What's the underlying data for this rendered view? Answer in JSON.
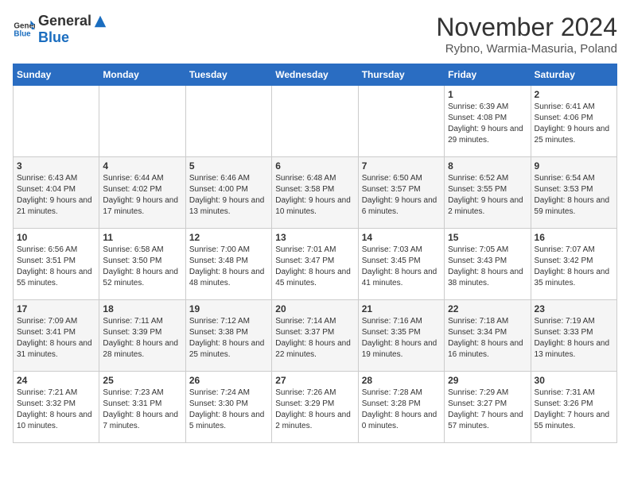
{
  "header": {
    "logo_general": "General",
    "logo_blue": "Blue",
    "title": "November 2024",
    "subtitle": "Rybno, Warmia-Masuria, Poland"
  },
  "days_of_week": [
    "Sunday",
    "Monday",
    "Tuesday",
    "Wednesday",
    "Thursday",
    "Friday",
    "Saturday"
  ],
  "weeks": [
    [
      {
        "day": "",
        "info": ""
      },
      {
        "day": "",
        "info": ""
      },
      {
        "day": "",
        "info": ""
      },
      {
        "day": "",
        "info": ""
      },
      {
        "day": "",
        "info": ""
      },
      {
        "day": "1",
        "info": "Sunrise: 6:39 AM\nSunset: 4:08 PM\nDaylight: 9 hours and 29 minutes."
      },
      {
        "day": "2",
        "info": "Sunrise: 6:41 AM\nSunset: 4:06 PM\nDaylight: 9 hours and 25 minutes."
      }
    ],
    [
      {
        "day": "3",
        "info": "Sunrise: 6:43 AM\nSunset: 4:04 PM\nDaylight: 9 hours and 21 minutes."
      },
      {
        "day": "4",
        "info": "Sunrise: 6:44 AM\nSunset: 4:02 PM\nDaylight: 9 hours and 17 minutes."
      },
      {
        "day": "5",
        "info": "Sunrise: 6:46 AM\nSunset: 4:00 PM\nDaylight: 9 hours and 13 minutes."
      },
      {
        "day": "6",
        "info": "Sunrise: 6:48 AM\nSunset: 3:58 PM\nDaylight: 9 hours and 10 minutes."
      },
      {
        "day": "7",
        "info": "Sunrise: 6:50 AM\nSunset: 3:57 PM\nDaylight: 9 hours and 6 minutes."
      },
      {
        "day": "8",
        "info": "Sunrise: 6:52 AM\nSunset: 3:55 PM\nDaylight: 9 hours and 2 minutes."
      },
      {
        "day": "9",
        "info": "Sunrise: 6:54 AM\nSunset: 3:53 PM\nDaylight: 8 hours and 59 minutes."
      }
    ],
    [
      {
        "day": "10",
        "info": "Sunrise: 6:56 AM\nSunset: 3:51 PM\nDaylight: 8 hours and 55 minutes."
      },
      {
        "day": "11",
        "info": "Sunrise: 6:58 AM\nSunset: 3:50 PM\nDaylight: 8 hours and 52 minutes."
      },
      {
        "day": "12",
        "info": "Sunrise: 7:00 AM\nSunset: 3:48 PM\nDaylight: 8 hours and 48 minutes."
      },
      {
        "day": "13",
        "info": "Sunrise: 7:01 AM\nSunset: 3:47 PM\nDaylight: 8 hours and 45 minutes."
      },
      {
        "day": "14",
        "info": "Sunrise: 7:03 AM\nSunset: 3:45 PM\nDaylight: 8 hours and 41 minutes."
      },
      {
        "day": "15",
        "info": "Sunrise: 7:05 AM\nSunset: 3:43 PM\nDaylight: 8 hours and 38 minutes."
      },
      {
        "day": "16",
        "info": "Sunrise: 7:07 AM\nSunset: 3:42 PM\nDaylight: 8 hours and 35 minutes."
      }
    ],
    [
      {
        "day": "17",
        "info": "Sunrise: 7:09 AM\nSunset: 3:41 PM\nDaylight: 8 hours and 31 minutes."
      },
      {
        "day": "18",
        "info": "Sunrise: 7:11 AM\nSunset: 3:39 PM\nDaylight: 8 hours and 28 minutes."
      },
      {
        "day": "19",
        "info": "Sunrise: 7:12 AM\nSunset: 3:38 PM\nDaylight: 8 hours and 25 minutes."
      },
      {
        "day": "20",
        "info": "Sunrise: 7:14 AM\nSunset: 3:37 PM\nDaylight: 8 hours and 22 minutes."
      },
      {
        "day": "21",
        "info": "Sunrise: 7:16 AM\nSunset: 3:35 PM\nDaylight: 8 hours and 19 minutes."
      },
      {
        "day": "22",
        "info": "Sunrise: 7:18 AM\nSunset: 3:34 PM\nDaylight: 8 hours and 16 minutes."
      },
      {
        "day": "23",
        "info": "Sunrise: 7:19 AM\nSunset: 3:33 PM\nDaylight: 8 hours and 13 minutes."
      }
    ],
    [
      {
        "day": "24",
        "info": "Sunrise: 7:21 AM\nSunset: 3:32 PM\nDaylight: 8 hours and 10 minutes."
      },
      {
        "day": "25",
        "info": "Sunrise: 7:23 AM\nSunset: 3:31 PM\nDaylight: 8 hours and 7 minutes."
      },
      {
        "day": "26",
        "info": "Sunrise: 7:24 AM\nSunset: 3:30 PM\nDaylight: 8 hours and 5 minutes."
      },
      {
        "day": "27",
        "info": "Sunrise: 7:26 AM\nSunset: 3:29 PM\nDaylight: 8 hours and 2 minutes."
      },
      {
        "day": "28",
        "info": "Sunrise: 7:28 AM\nSunset: 3:28 PM\nDaylight: 8 hours and 0 minutes."
      },
      {
        "day": "29",
        "info": "Sunrise: 7:29 AM\nSunset: 3:27 PM\nDaylight: 7 hours and 57 minutes."
      },
      {
        "day": "30",
        "info": "Sunrise: 7:31 AM\nSunset: 3:26 PM\nDaylight: 7 hours and 55 minutes."
      }
    ]
  ]
}
